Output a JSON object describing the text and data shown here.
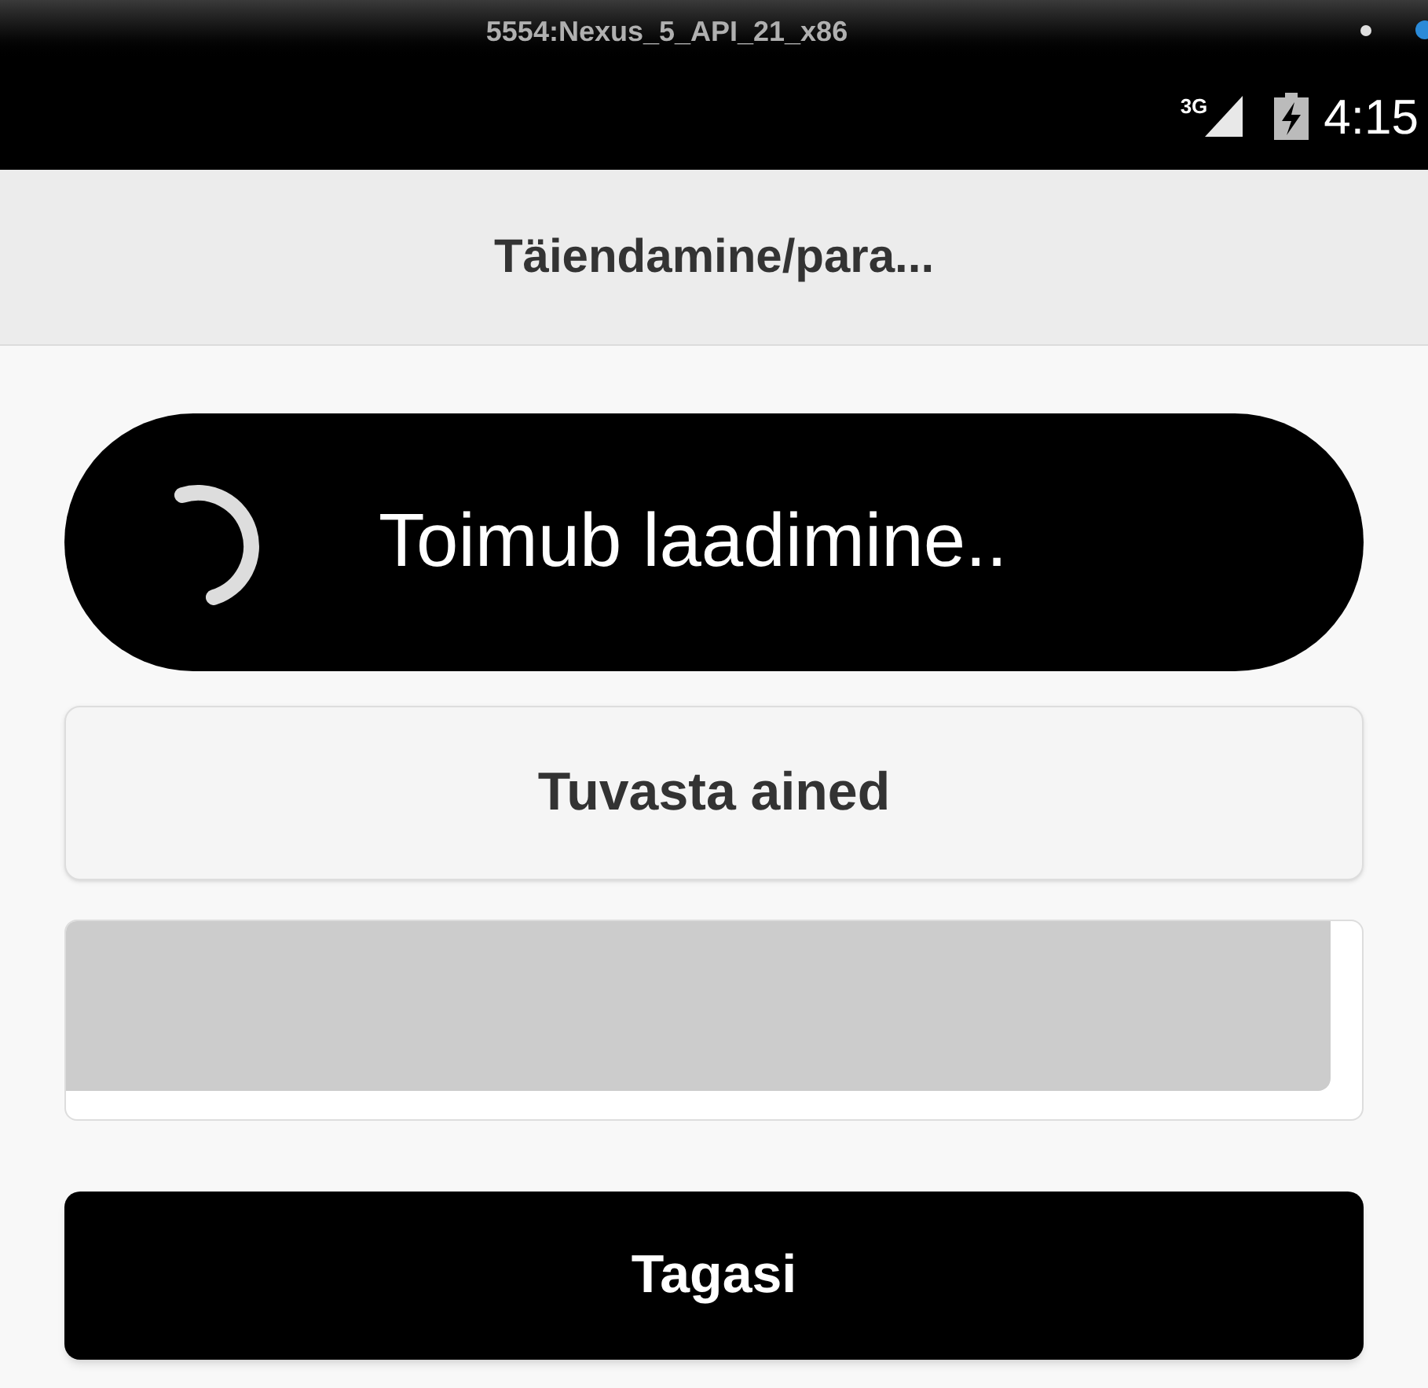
{
  "emulator_window": {
    "title": "5554:Nexus_5_API_21_x86"
  },
  "status_bar": {
    "network": "3G",
    "time": "4:15"
  },
  "header": {
    "title": "Täiendamine/para..."
  },
  "loading": {
    "message": "Toimub laadimine.."
  },
  "detect_button": {
    "label": "Tuvasta ained"
  },
  "text_area": {
    "disabled": true
  },
  "back_button": {
    "label": "Tagasi"
  }
}
